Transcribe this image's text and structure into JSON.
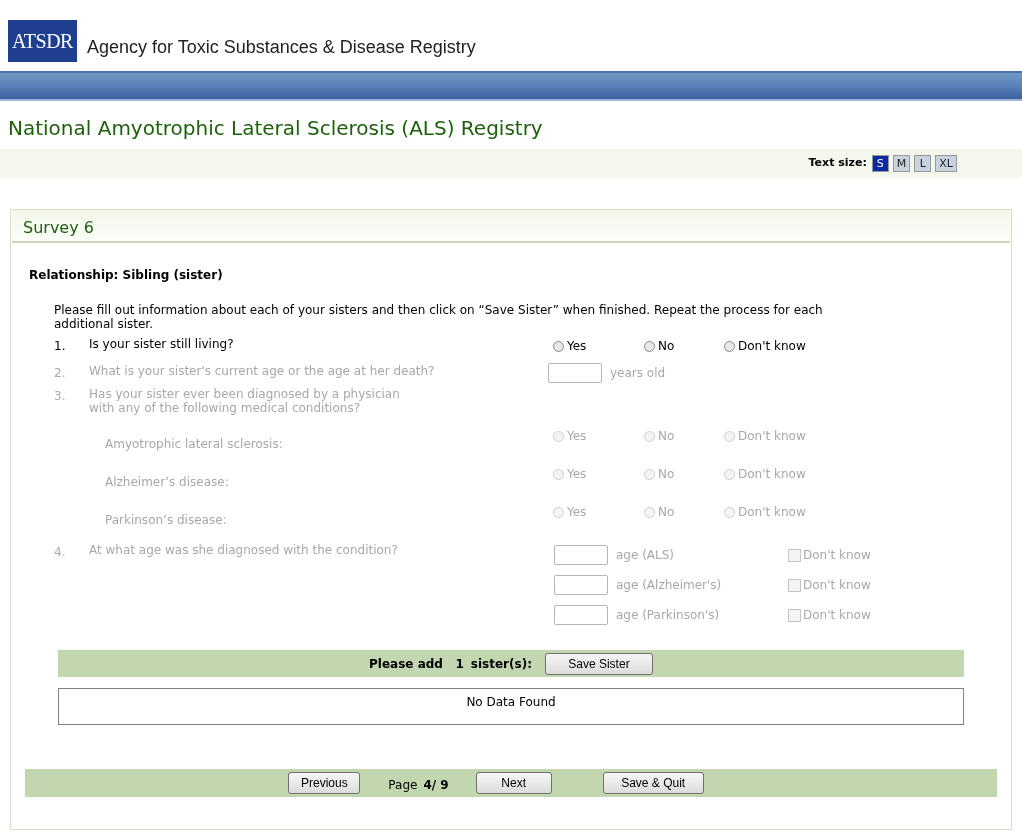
{
  "header": {
    "logo": "ATSDR",
    "agency": "Agency for Toxic Substances & Disease Registry"
  },
  "registry_title": "National Amyotrophic Lateral Sclerosis (ALS) Registry",
  "text_size": {
    "label": "Text size:",
    "options": [
      {
        "label": "S",
        "selected": true
      },
      {
        "label": "M",
        "selected": false
      },
      {
        "label": "L",
        "selected": false
      },
      {
        "label": "XL",
        "selected": false
      }
    ]
  },
  "survey": {
    "title": "Survey 6",
    "relationship": "Relationship: Sibling (sister)",
    "instruction": "Please fill out information about each of your sisters and then click on “Save Sister” when finished. Repeat the process for each additional sister.",
    "questions": [
      {
        "kind": "radio",
        "number": "1.",
        "lines": [
          "Is your sister still living?"
        ],
        "disabled": false,
        "options": [
          {
            "label": "Yes",
            "selected": false
          },
          {
            "label": "No",
            "selected": false
          },
          {
            "label": "Don't know",
            "selected": false
          }
        ]
      },
      {
        "kind": "age",
        "number": "2.",
        "lines": [
          "What is your sister's current age or the age at her death?"
        ],
        "disabled": true,
        "suffix": "years old"
      },
      {
        "kind": "conditions",
        "number": "3.",
        "lines": [
          "Has your sister ever been diagnosed by a physician",
          "with any of the following medical conditions?"
        ],
        "disabled": true,
        "conditions": [
          {
            "label": "Amyotrophic lateral sclerosis:",
            "options": [
              {
                "label": "Yes",
                "selected": false
              },
              {
                "label": "No",
                "selected": false
              },
              {
                "label": "Don't know",
                "selected": false
              }
            ]
          },
          {
            "label": "Alzheimer’s disease:",
            "options": [
              {
                "label": "Yes",
                "selected": false
              },
              {
                "label": "No",
                "selected": false
              },
              {
                "label": "Don't know",
                "selected": false
              }
            ]
          },
          {
            "label": "Parkinson’s disease:",
            "options": [
              {
                "label": "Yes",
                "selected": false
              },
              {
                "label": "No",
                "selected": false
              },
              {
                "label": "Don't know",
                "selected": false
              }
            ]
          }
        ]
      },
      {
        "kind": "age_list",
        "number": "4.",
        "lines": [
          "At what age was she diagnosed with the condition?"
        ],
        "disabled": true,
        "rows": [
          {
            "suffix": "age (ALS)",
            "checkbox": "Don't know",
            "checked": false
          },
          {
            "suffix": "age (Alzheimer's)",
            "checkbox": "Don't know",
            "checked": false
          },
          {
            "suffix": "age (Parkinson's)",
            "checkbox": "Don't know",
            "checked": false
          }
        ]
      }
    ],
    "add_bar": {
      "label": "Please add",
      "count": "1",
      "unit": "sister(s):",
      "button": "Save Sister"
    },
    "empty_message": "No Data Found",
    "nav": {
      "previous": "Previous",
      "page_label": "Page",
      "page": "4/ 9",
      "next": "Next",
      "save_quit": "Save & Quit"
    }
  }
}
